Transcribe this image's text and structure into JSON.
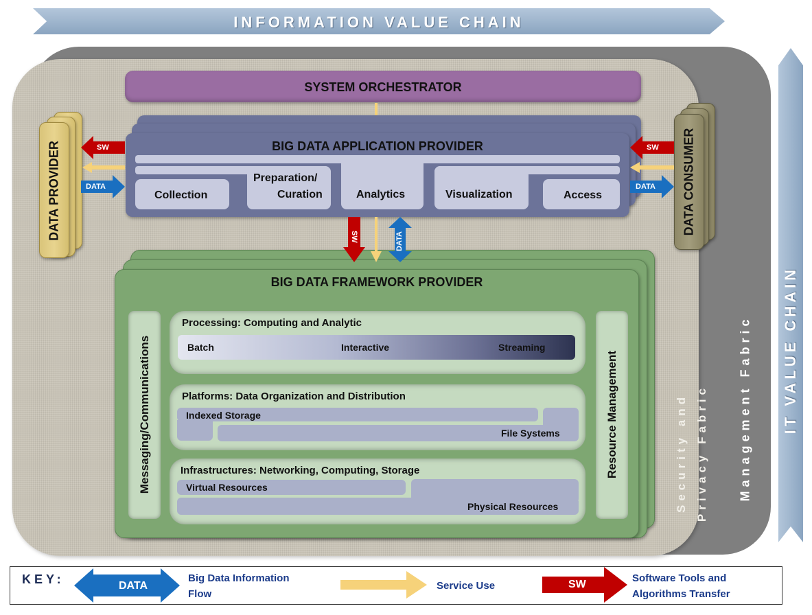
{
  "banners": {
    "information_value_chain": "INFORMATION VALUE CHAIN",
    "it_value_chain": "IT VALUE CHAIN"
  },
  "fabrics": {
    "management": "Management Fabric",
    "security_line1": "Security and",
    "security_line2": "Privacy Fabric"
  },
  "system_orchestrator": "SYSTEM ORCHESTRATOR",
  "data_provider": "DATA PROVIDER",
  "data_consumer": "DATA CONSUMER",
  "application_provider": {
    "title": "BIG DATA APPLICATION PROVIDER",
    "activities": [
      "Collection",
      "Preparation/\nCuration",
      "Analytics",
      "Visualization",
      "Access"
    ],
    "collection": "Collection",
    "preparation_line1": "Preparation/",
    "preparation_line2": "Curation",
    "analytics": "Analytics",
    "visualization": "Visualization",
    "access": "Access"
  },
  "framework_provider": {
    "title": "BIG DATA FRAMEWORK PROVIDER",
    "messaging": "Messaging/Communications",
    "resource_management": "Resource Management",
    "processing": {
      "title": "Processing: Computing and Analytic",
      "batch": "Batch",
      "interactive": "Interactive",
      "streaming": "Streaming"
    },
    "platforms": {
      "title": "Platforms: Data Organization and Distribution",
      "indexed_storage": "Indexed Storage",
      "file_systems": "File Systems"
    },
    "infrastructures": {
      "title": "Infrastructures: Networking, Computing, Storage",
      "virtual_resources": "Virtual Resources",
      "physical_resources": "Physical Resources"
    }
  },
  "arrow_labels": {
    "sw": "SW",
    "data": "DATA"
  },
  "key": {
    "title": "KEY:",
    "data_label": "DATA",
    "data_desc_line1": "Big Data Information",
    "data_desc_line2": "Flow",
    "service_desc": "Service Use",
    "sw_label": "SW",
    "sw_desc_line1": "Software Tools and",
    "sw_desc_line2": "Algorithms Transfer"
  },
  "colors": {
    "data_arrow": "#1a6fc0",
    "sw_arrow": "#c00000",
    "service_arrow": "#f6d27a",
    "orchestrator": "#9a6da2",
    "application_provider": "#6c7399",
    "framework_provider": "#7ea772",
    "data_provider": "#e3cd82",
    "data_consumer": "#9b9575",
    "management_fabric": "#7f7f7f",
    "value_chain": "#9db4cc"
  }
}
